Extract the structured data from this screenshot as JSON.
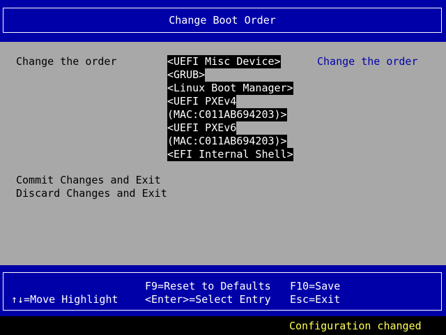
{
  "window": {
    "title": "Change Boot Order"
  },
  "main": {
    "option_label": "Change the order",
    "help_text": "Change the order",
    "boot_entries": [
      "<UEFI Misc Device>",
      "<GRUB>",
      "<Linux Boot Manager>",
      "<UEFI PXEv4",
      "(MAC:C011AB694203)>",
      "<UEFI PXEv6",
      "(MAC:C011AB694203)>",
      "<EFI Internal Shell>"
    ],
    "commit_label": "Commit Changes and Exit",
    "discard_label": "Discard Changes and Exit"
  },
  "footer": {
    "move_highlight": "↑↓=Move Highlight",
    "reset_defaults": "F9=Reset to Defaults",
    "select_entry": "<Enter>=Select Entry",
    "save": "F10=Save",
    "exit": "Esc=Exit"
  },
  "status": {
    "message": "Configuration changed"
  },
  "colors": {
    "background_gray": "#a8a8a8",
    "bios_blue": "#0000a8",
    "status_yellow": "#ffff54",
    "highlight_black": "#000000"
  }
}
